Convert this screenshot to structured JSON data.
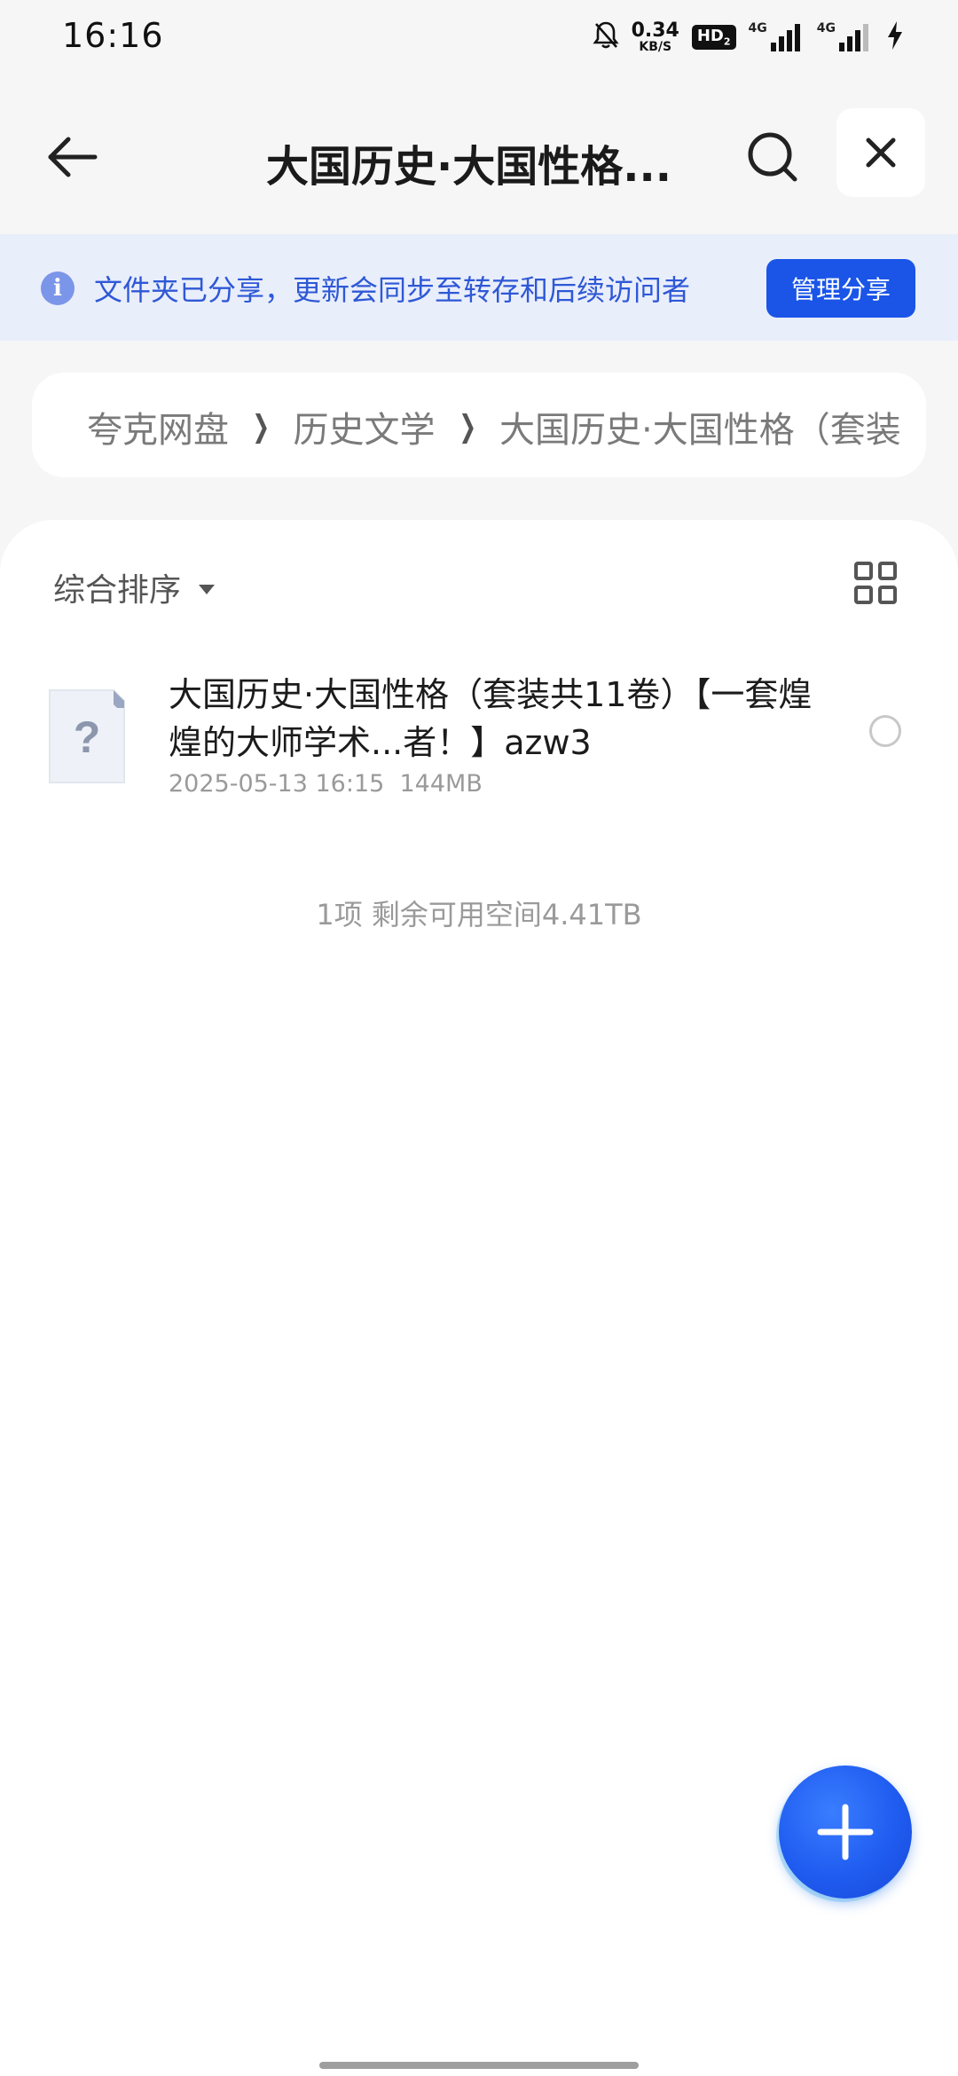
{
  "status_bar": {
    "time": "16:16",
    "net_speed_value": "0.34",
    "net_speed_unit": "KB/S",
    "hd_label": "HD",
    "hd_sub": "2",
    "sim1_label": "4G",
    "sim2_label": "4G",
    "icons": [
      "bell-off-icon",
      "signal-icon",
      "charging-icon"
    ]
  },
  "header": {
    "title": "大国历史·大国性格...",
    "back_icon": "arrow-left-icon",
    "search_icon": "search-icon",
    "close_icon": "close-icon"
  },
  "share_banner": {
    "text": "文件夹已分享，更新会同步至转存和后续访问者",
    "button_label": "管理分享",
    "accent_color": "#1a55e8"
  },
  "breadcrumb": {
    "items": [
      "夸克网盘",
      "历史文学",
      "大国历史·大国性格（套装"
    ]
  },
  "list": {
    "sort_label": "综合排序",
    "view_toggle_icon": "grid-view-icon",
    "files": [
      {
        "name": "大国历史·大国性格（套装共11卷）【一套煌煌的大师学术...者！】azw3",
        "date": "2025-05-13 16:15",
        "size": "144MB",
        "icon": "unknown-file-icon"
      }
    ],
    "summary": "1项  剩余可用空间4.41TB"
  },
  "fab": {
    "icon": "plus-icon"
  }
}
